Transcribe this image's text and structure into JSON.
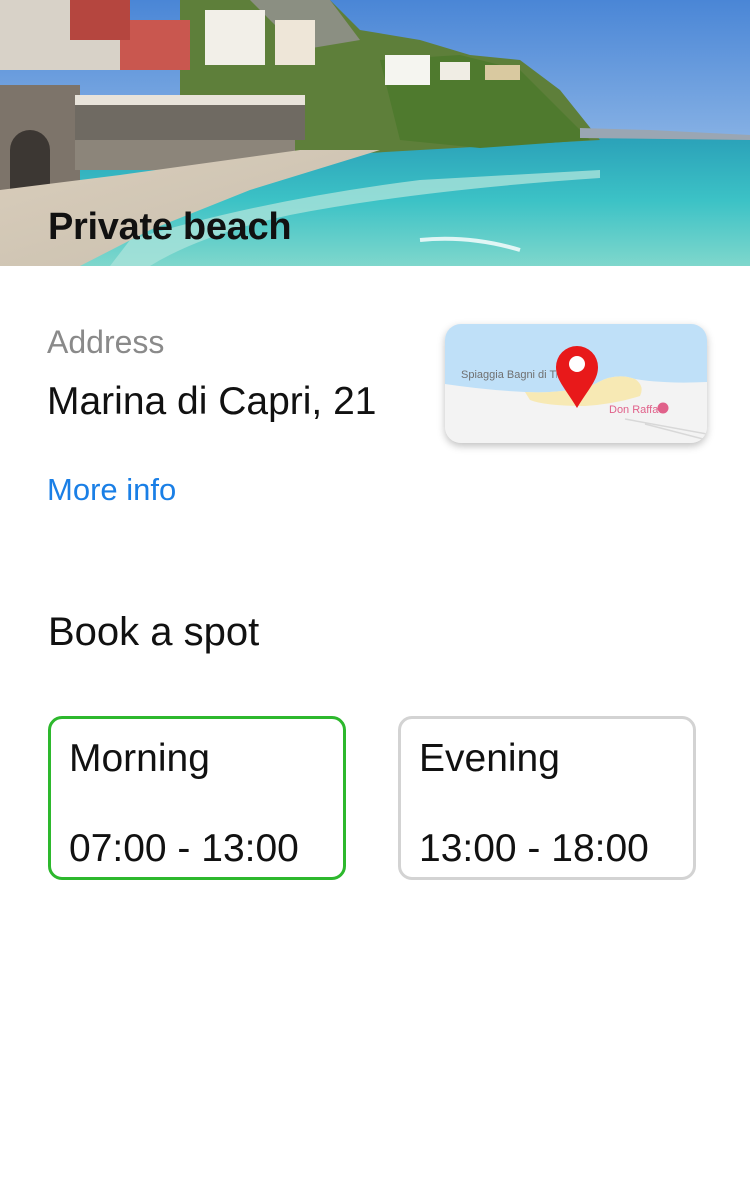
{
  "hero": {
    "title": "Private beach"
  },
  "address": {
    "label": "Address",
    "value": "Marina di Capri, 21",
    "more_info": "More info"
  },
  "map": {
    "place_label_1": "Spiaggia Bagni di Tiberio",
    "place_label_2": "Don Raffaè",
    "pin_color": "#e8191a"
  },
  "booking": {
    "title": "Book a spot",
    "slots": [
      {
        "name": "Morning",
        "time": "07:00 - 13:00",
        "selected": true
      },
      {
        "name": "Evening",
        "time": "13:00 - 18:00",
        "selected": false
      }
    ]
  },
  "colors": {
    "link": "#1a7fe6",
    "selected_border": "#2db82d",
    "unselected_border": "#d3d3d3"
  }
}
